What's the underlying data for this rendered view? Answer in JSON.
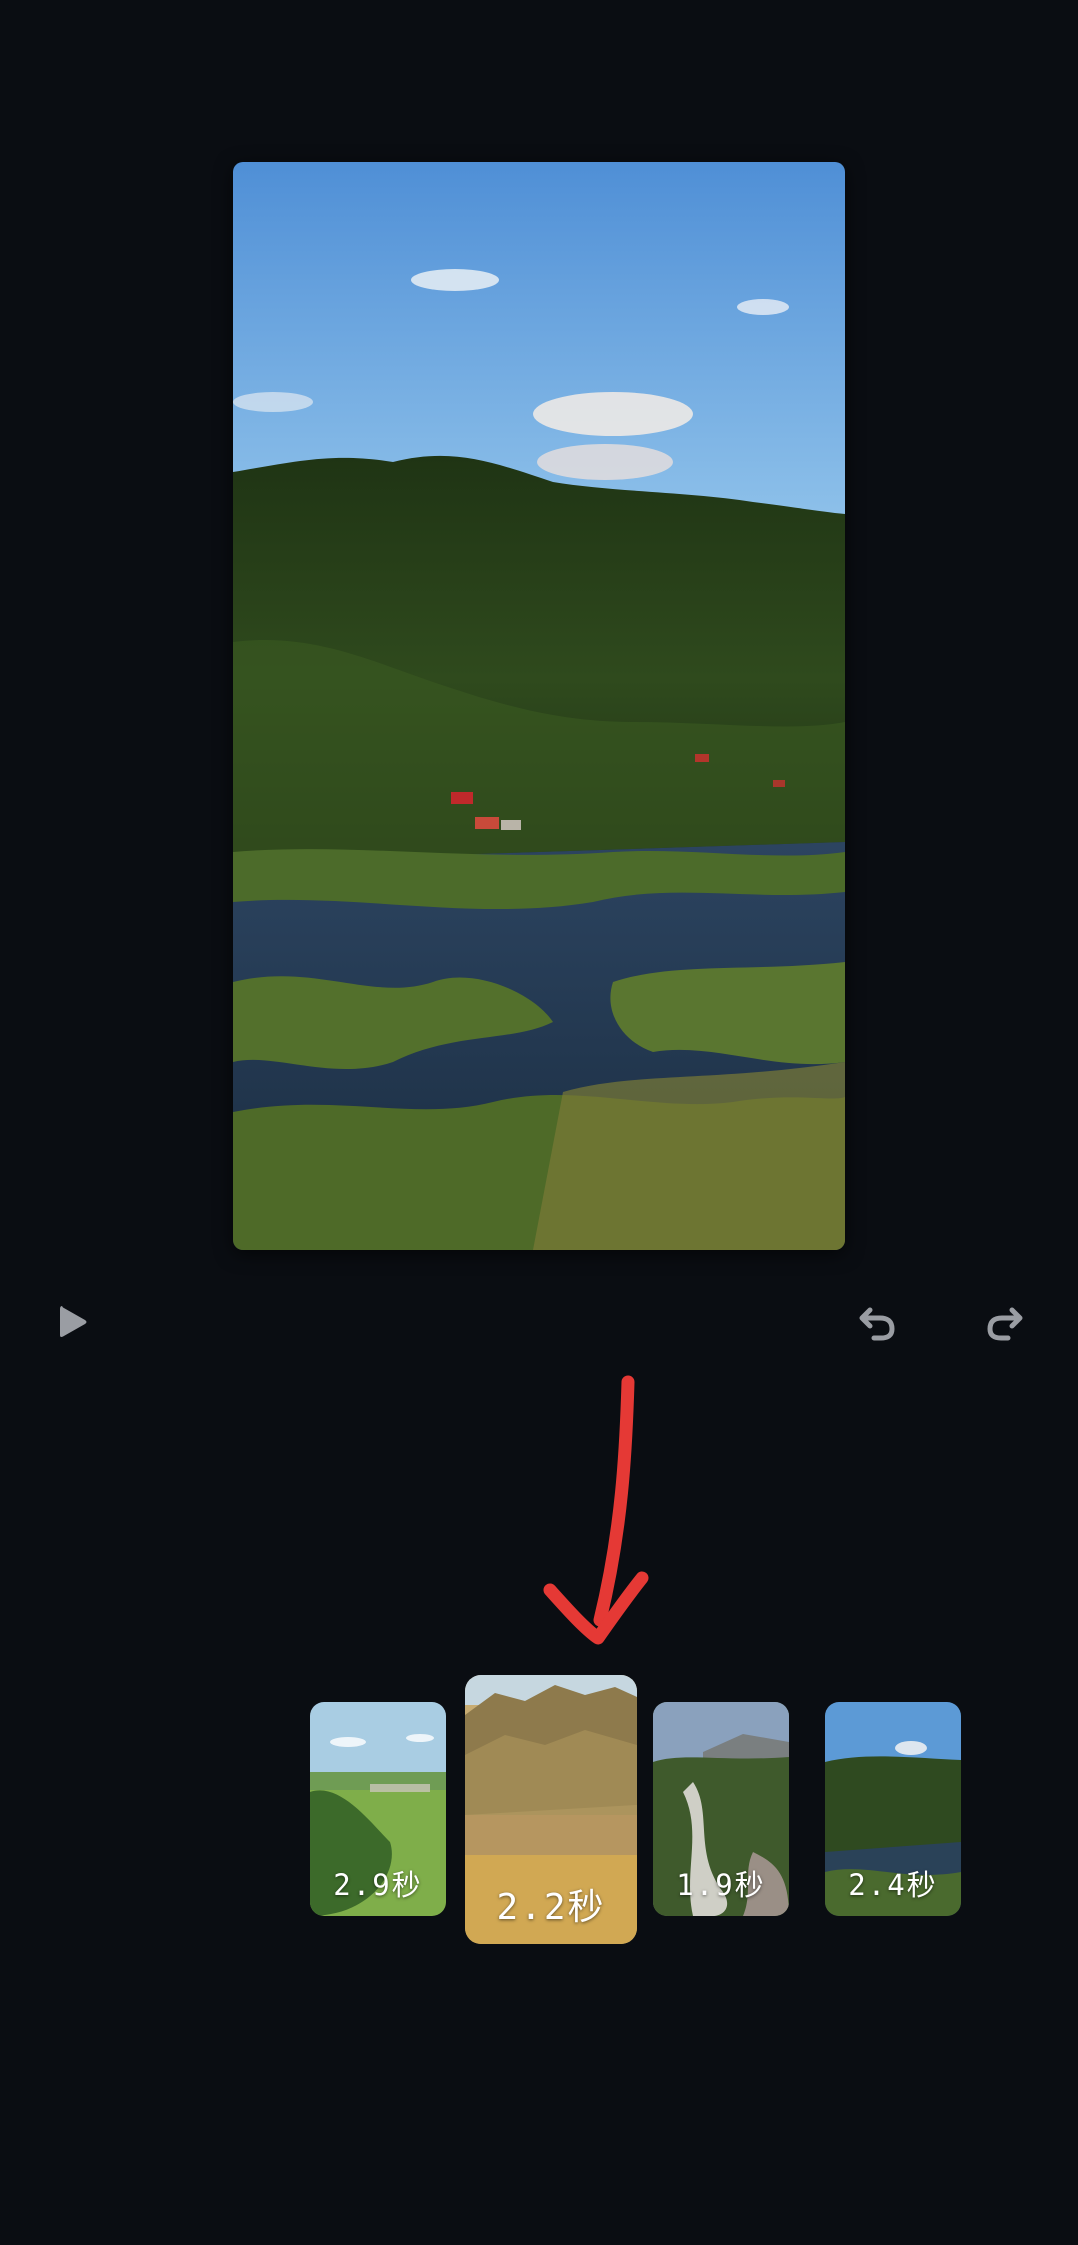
{
  "toolbar": {
    "play_icon": "play-icon",
    "undo_icon": "undo-icon",
    "redo_icon": "redo-icon"
  },
  "annotation": {
    "color": "#e53935"
  },
  "timeline": {
    "clips": [
      {
        "duration": "2.9秒",
        "selected": false
      },
      {
        "duration": "2.2秒",
        "selected": true
      },
      {
        "duration": "1.9秒",
        "selected": false
      },
      {
        "duration": "2.4秒",
        "selected": false
      }
    ]
  },
  "colors": {
    "background": "#0a0d12",
    "icon": "#9a9da3"
  }
}
